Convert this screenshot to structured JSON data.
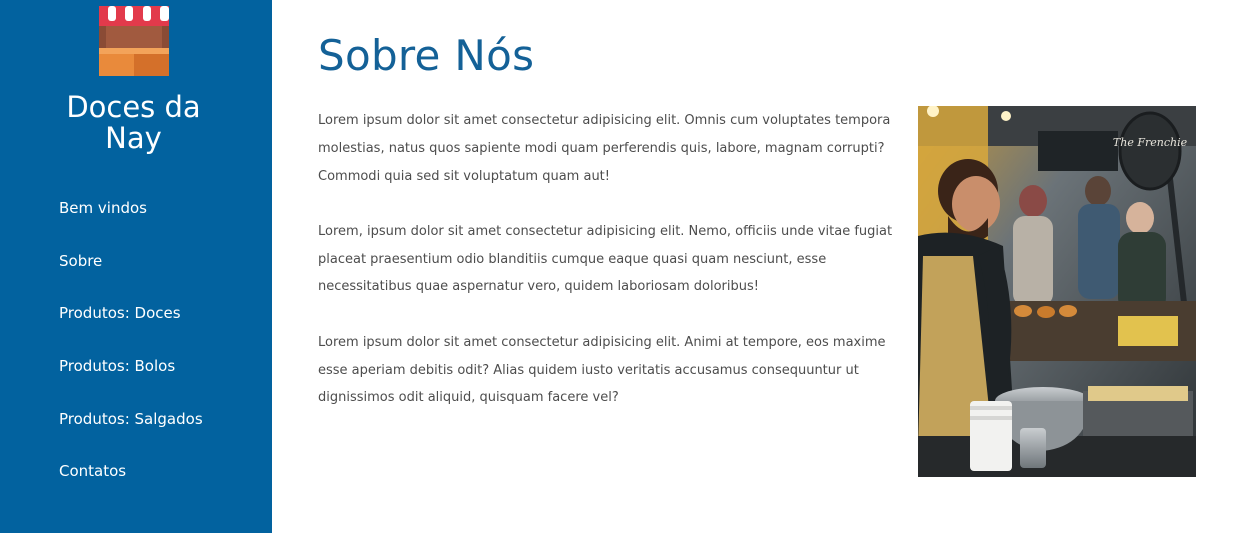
{
  "brand": {
    "line1": "Doces da",
    "line2": "Nay"
  },
  "nav": {
    "items": [
      {
        "label": "Bem vindos"
      },
      {
        "label": "Sobre"
      },
      {
        "label": "Produtos: Doces"
      },
      {
        "label": "Produtos: Bolos"
      },
      {
        "label": "Produtos: Salgados"
      },
      {
        "label": "Contatos"
      }
    ]
  },
  "main": {
    "title": "Sobre Nós",
    "paragraphs": [
      "Lorem ipsum dolor sit amet consectetur adipisicing elit. Omnis cum voluptates tempora molestias, natus quos sapiente modi quam perferendis quis, labore, magnam corrupti? Commodi quia sed sit voluptatum quam aut!",
      "Lorem, ipsum dolor sit amet consectetur adipisicing elit. Nemo, officiis unde vitae fugiat placeat praesentium odio blanditiis cumque eaque quasi quam nesciunt, esse necessitatibus quae aspernatur vero, quidem laboriosam doloribus!",
      "Lorem ipsum dolor sit amet consectetur adipisicing elit. Animi at tempore, eos maxime esse aperiam debitis odit? Alias quidem iusto veritatis accusamus consequuntur ut dignissimos odit aliquid, quisquam facere vel?"
    ],
    "photo_sign": "The Frenchie"
  },
  "colors": {
    "sidebar": "#02629f",
    "title": "#146197",
    "text": "#4d4d4d"
  },
  "icons": {
    "logo": "market-stall-icon"
  }
}
